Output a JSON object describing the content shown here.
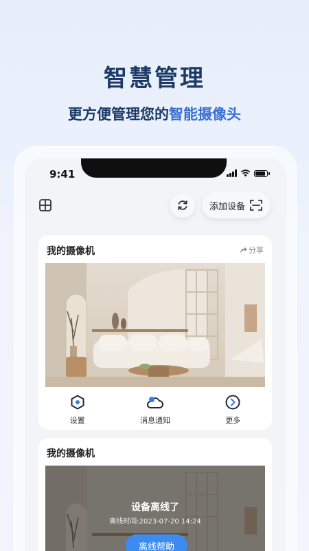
{
  "hero": {
    "title": "智慧管理",
    "subtitle_prefix": "更方便管理您的",
    "subtitle_highlight": "智能摄像头"
  },
  "status_bar": {
    "time": "9:41"
  },
  "toolbar": {
    "add_device_label": "添加设备"
  },
  "cameras": [
    {
      "name": "我的摄像机",
      "share_label": "分享",
      "status": "online",
      "actions": [
        {
          "label": "设置",
          "icon": "hexagon-settings-icon"
        },
        {
          "label": "消息通知",
          "icon": "cloud-notification-icon"
        },
        {
          "label": "更多",
          "icon": "chevron-right-circle-icon"
        }
      ]
    },
    {
      "name": "我的摄像机",
      "status": "offline",
      "offline_title": "设备离线了",
      "offline_time": "离线时间:2023-07-20 14:24",
      "help_label": "离线帮助"
    }
  ],
  "colors": {
    "brand_dark": "#1d3a66",
    "brand_highlight": "#3a6fd6",
    "button_blue": "#3c8cf0"
  }
}
